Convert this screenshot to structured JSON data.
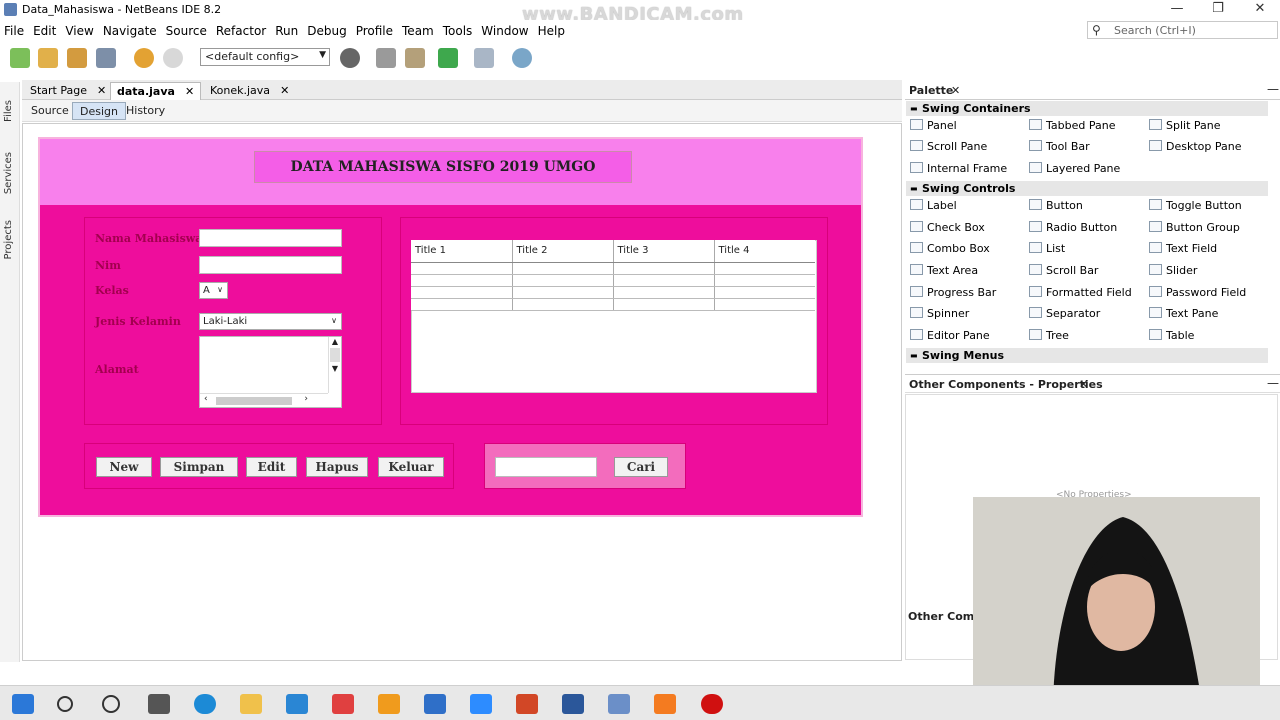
{
  "window": {
    "title": "Data_Mahasiswa - NetBeans IDE 8.2",
    "watermark": "www.BANDICAM.com",
    "controls": [
      "—",
      "❐",
      "✕"
    ]
  },
  "menu": [
    "File",
    "Edit",
    "View",
    "Navigate",
    "Source",
    "Refactor",
    "Run",
    "Debug",
    "Profile",
    "Team",
    "Tools",
    "Window",
    "Help"
  ],
  "search": {
    "icon": "search-icon",
    "placeholder": "Search (Ctrl+I)"
  },
  "toolbar": {
    "config": "<default config>"
  },
  "side_tabs": [
    "Files",
    "Services",
    "Projects"
  ],
  "editor_tabs": [
    {
      "label": "Start Page",
      "active": false
    },
    {
      "label": "data.java",
      "active": true
    },
    {
      "label": "Konek.java",
      "active": false
    }
  ],
  "sub_tabs": [
    "Source",
    "Design",
    "History"
  ],
  "form": {
    "title": "DATA MAHASISWA SISFO 2019 UMGO",
    "labels": {
      "nama": "Nama Mahasiswa",
      "nim": "Nim",
      "kelas": "Kelas",
      "jenis_kelamin": "Jenis Kelamin",
      "alamat": "Alamat"
    },
    "kelas_value": "A",
    "jk_value": "Laki-Laki",
    "table_headers": [
      "Title 1",
      "Title 2",
      "Title 3",
      "Title 4"
    ],
    "buttons": [
      "New",
      "Simpan",
      "Edit",
      "Hapus",
      "Keluar"
    ],
    "search_button": "Cari",
    "colors": {
      "bg": "#ee0d9c",
      "header": "#f880ec",
      "title_box": "#f45ee7"
    }
  },
  "palette": {
    "title": "Palette",
    "categories": {
      "containers": "Swing Containers",
      "controls": "Swing Controls",
      "menus": "Swing Menus"
    },
    "containers": [
      "Panel",
      "Tabbed Pane",
      "Split Pane",
      "Scroll Pane",
      "Tool Bar",
      "Desktop Pane",
      "Internal Frame",
      "Layered Pane"
    ],
    "controls": [
      "Label",
      "Button",
      "Toggle Button",
      "Check Box",
      "Radio Button",
      "Button Group",
      "Combo Box",
      "List",
      "Text Field",
      "Text Area",
      "Scroll Bar",
      "Slider",
      "Progress Bar",
      "Formatted Field",
      "Password Field",
      "Spinner",
      "Separator",
      "Text Pane",
      "Editor Pane",
      "Tree",
      "Table"
    ]
  },
  "properties": {
    "title": "Other Components - Properties",
    "empty": "<No Properties>",
    "bottom": "Other Compo"
  }
}
